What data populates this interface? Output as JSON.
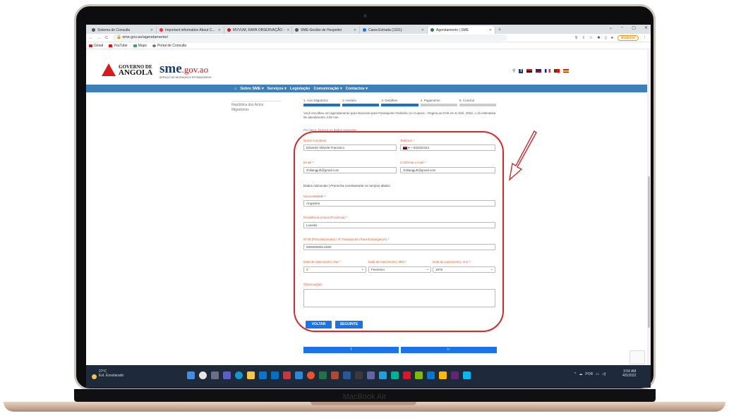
{
  "browser": {
    "tabs": [
      {
        "label": "Sistema de Consulta",
        "active": false
      },
      {
        "label": "Important information About C...",
        "active": false
      },
      {
        "label": "MVVUM, RAPA OBSERVAÇÃO -",
        "active": false
      },
      {
        "label": "SME-Gestão de Hospedei",
        "active": false
      },
      {
        "label": "Caixa Entrada (1331)",
        "active": false
      },
      {
        "label": "Agendamento | SME",
        "active": true
      }
    ],
    "url": "sme.gov.ao/agendamento/",
    "update_label": "Atualizar",
    "bookmarks": [
      "Gmail",
      "YouTube",
      "Maps",
      "Portal de Consulta"
    ]
  },
  "site": {
    "gov_line1": "GOVERNO DE",
    "gov_line2": "ANGOLA",
    "sme_logo": "sme",
    "sme_tld": ".gov.ao",
    "sme_sub": "SERVIÇO DE MIGRAÇÃO E ESTRANGEIROS",
    "nav": [
      "Sobre SME",
      "Serviços",
      "Legislação",
      "Comunicação",
      "Contactos"
    ],
    "sidebar_link": "República dos Actos Migratórios"
  },
  "steps": [
    "1. Acto Migratório",
    "2. Horário",
    "3. Detalhes",
    "4. Pagamento",
    "5. Concluir"
  ],
  "intro": "Você escolheu um agendamento para Nacional para Passaporte Ordinário no Cuanza - Origina as 8:00 em 6 Abril, 2022, o Já estimativa de atendimento 4:00 min.",
  "intro2": "Por favor, forneça os dados seguintes",
  "form": {
    "nome_label": "Nome Completo",
    "nome_value": "Eduardo Vilande Francisco",
    "telefone_label": "Telefone *",
    "telefone_value": "+ 933322344",
    "email_label": "Email *",
    "email_value": "zhiliangjuh@gmail.com",
    "confirm_label": "Confirmar e-mail *",
    "confirm_value": "zhiliangjuh@gmail.com",
    "dados_adicionais": "Dados Adicionais | Preencha corretamente os campos abaixo",
    "nacionalidade_label": "Nacionalidade *",
    "nacionalidade_value": "Angolana",
    "residencia_label": "Residência Actual (Província) *",
    "residencia_value": "Luanda",
    "bi_label": "Nº BI (Para Nacionais) / Nº Passaporte (Para Estrangeiros) *",
    "bi_value": "000000000LA000",
    "dia_label": "Data de nascimento: Dia *",
    "dia_value": "4",
    "mes_label": "Data de nascimento: Mês *",
    "mes_value": "Fevereiro",
    "ano_label": "Data de nascimento: Ano *",
    "ano_value": "1975",
    "obs_label": "Observações",
    "voltar_label": "VOLTAR",
    "seguinte_label": "SEGUINTE"
  },
  "taskbar": {
    "temp": "27ºC",
    "weather": "Ext. Ensolarado",
    "lang": "POR",
    "time": "3:54 AM",
    "date": "4/5/2022"
  },
  "device_label": "MacBook Air"
}
